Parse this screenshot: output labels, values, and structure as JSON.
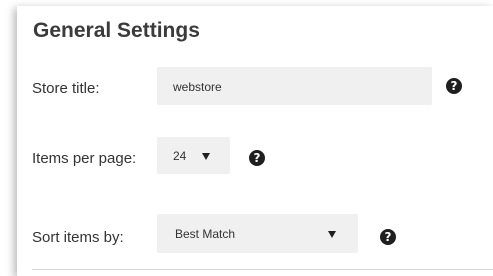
{
  "section": {
    "title": "General Settings"
  },
  "fields": {
    "store_title": {
      "label": "Store title:",
      "value": "webstore",
      "help_glyph": "?"
    },
    "items_per_page": {
      "label": "Items per page:",
      "value": "24",
      "help_glyph": "?"
    },
    "sort_items_by": {
      "label": "Sort items by:",
      "value": "Best Match",
      "help_glyph": "?"
    }
  },
  "icons": {
    "help": "question-circle-icon",
    "dropdown": "caret-down-icon"
  }
}
